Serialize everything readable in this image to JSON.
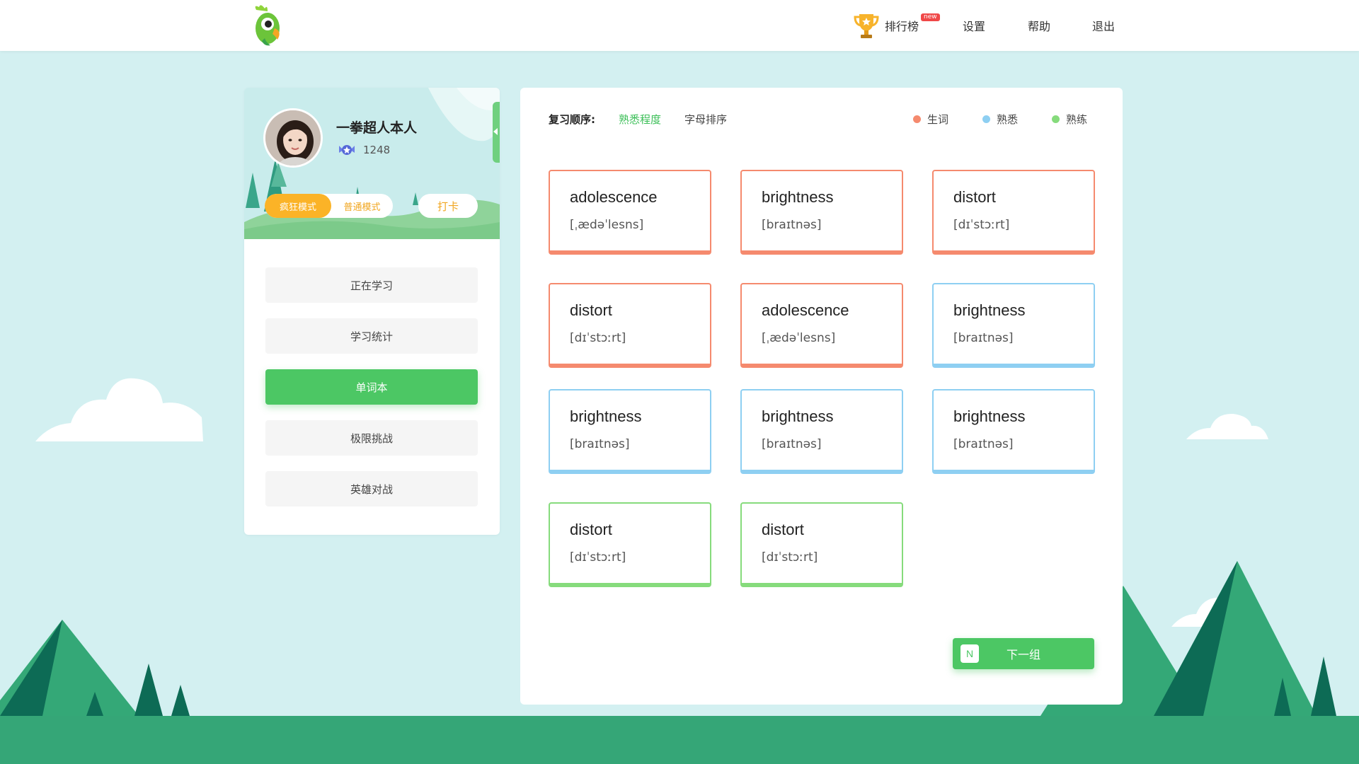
{
  "header": {
    "nav": {
      "rank": "排行榜",
      "new_badge": "new",
      "settings": "设置",
      "help": "帮助",
      "logout": "退出"
    }
  },
  "profile": {
    "username": "一拳超人本人",
    "score": "1248",
    "mode_crazy": "疯狂模式",
    "mode_normal": "普通模式",
    "checkin": "打卡"
  },
  "menu": {
    "items": [
      {
        "label": "正在学习",
        "active": false
      },
      {
        "label": "学习统计",
        "active": false
      },
      {
        "label": "单词本",
        "active": true
      },
      {
        "label": "极限挑战",
        "active": false
      },
      {
        "label": "英雄对战",
        "active": false
      }
    ]
  },
  "review": {
    "sort_label": "复习顺序:",
    "sort_familiarity": "熟悉程度",
    "sort_alphabet": "字母排序",
    "legend": {
      "new": "生词",
      "familiar": "熟悉",
      "mastered": "熟练"
    },
    "colors": {
      "new": "#f58a6e",
      "familiar": "#8ecff2",
      "mastered": "#86db7c",
      "accent": "#4cc764"
    },
    "cards": [
      {
        "word": "adolescence",
        "phonetic": "[ˌædəˈlesns]",
        "status": "new"
      },
      {
        "word": "brightness",
        "phonetic": "[braɪtnəs]",
        "status": "new"
      },
      {
        "word": "distort",
        "phonetic": "[dɪˈstɔːrt]",
        "status": "new"
      },
      {
        "word": "distort",
        "phonetic": "[dɪˈstɔːrt]",
        "status": "new"
      },
      {
        "word": "adolescence",
        "phonetic": "[ˌædəˈlesns]",
        "status": "new"
      },
      {
        "word": "brightness",
        "phonetic": "[braɪtnəs]",
        "status": "familiar"
      },
      {
        "word": "brightness",
        "phonetic": "[braɪtnəs]",
        "status": "familiar"
      },
      {
        "word": "brightness",
        "phonetic": "[braɪtnəs]",
        "status": "familiar"
      },
      {
        "word": "brightness",
        "phonetic": "[braɪtnəs]",
        "status": "familiar"
      },
      {
        "word": "distort",
        "phonetic": "[dɪˈstɔːrt]",
        "status": "mastered"
      },
      {
        "word": "distort",
        "phonetic": "[dɪˈstɔːrt]",
        "status": "mastered"
      }
    ],
    "next_key": "N",
    "next_label": "下一组"
  }
}
